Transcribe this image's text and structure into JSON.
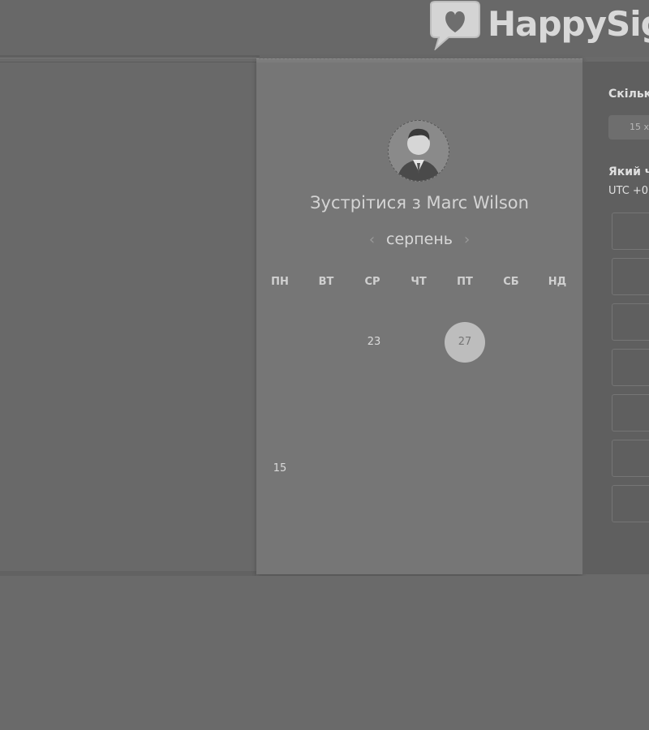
{
  "brand": {
    "name": "HappySig"
  },
  "header": {
    "title": "Зустрітися з Marc Wilson"
  },
  "calendar": {
    "month": "серпень",
    "weekdays": [
      "ПН",
      "ВТ",
      "СР",
      "ЧТ",
      "ПТ",
      "СБ",
      "НД"
    ],
    "weeks": [
      [
        "",
        "",
        "",
        "",
        "",
        "",
        ""
      ],
      [
        "",
        "",
        "23",
        "",
        "27",
        "",
        ""
      ],
      [
        "",
        "",
        "",
        "",
        "",
        "",
        ""
      ],
      [
        "",
        "",
        "",
        "",
        "",
        "",
        ""
      ],
      [
        "15",
        "",
        "",
        "",
        "",
        "",
        ""
      ]
    ],
    "selected_day": "27"
  },
  "booking": {
    "duration_label": "Скільк",
    "duration_value": "15 х",
    "timezone_label": "Який ч",
    "timezone_value": "UTC +0"
  },
  "colors": {
    "selected_day_bg": "#bdbdbd",
    "card_bg": "#767676",
    "page_bg": "#6a6a6a"
  }
}
